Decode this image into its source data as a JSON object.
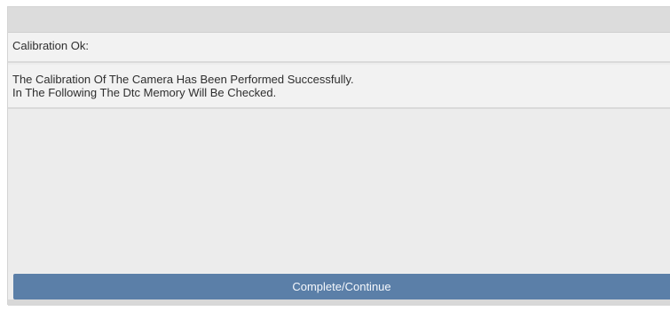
{
  "dialog": {
    "heading": "Calibration Ok:",
    "message_lines": [
      "The Calibration Of The Camera Has Been Performed Successfully.",
      "In The Following The Dtc Memory Will Be Checked."
    ],
    "primary_button_label": "Complete/Continue"
  },
  "colors": {
    "button_background": "#5b7fa8",
    "button_text": "#f5f8fc",
    "panel_background": "#f2f2f2",
    "top_bar": "#dcdcdc"
  }
}
